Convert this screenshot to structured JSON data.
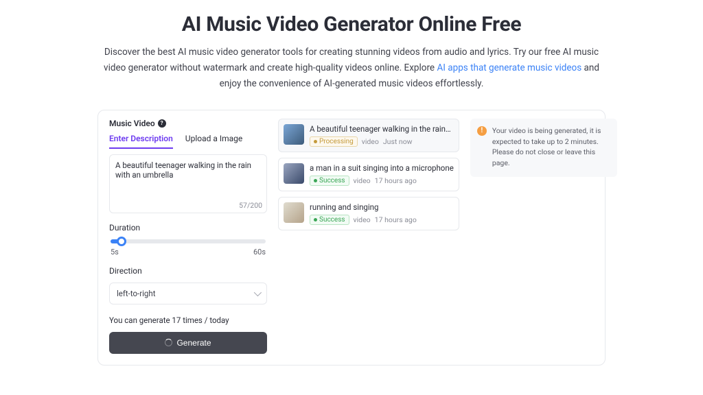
{
  "hero": {
    "title": "AI Music Video Generator Online Free",
    "desc_1": "Discover the best AI music video generator tools for creating stunning videos from audio and lyrics. Try our free AI music video generator without watermark and create high-quality videos online. Explore ",
    "link_text": "AI apps that generate music videos",
    "desc_2": " and enjoy the convenience of AI-generated music videos effortlessly."
  },
  "form": {
    "section_label": "Music Video",
    "tabs": {
      "enter_desc": "Enter Description",
      "upload_img": "Upload a Image"
    },
    "prompt_value": "A beautiful teenager walking in the rain with an umbrella",
    "char_count": "57/200",
    "duration_label": "Duration",
    "duration_min": "5s",
    "duration_max": "60s",
    "direction_label": "Direction",
    "direction_value": "left-to-right",
    "remaining_text": "You can generate 17 times / today",
    "generate_label": "Generate"
  },
  "jobs": [
    {
      "title": "A beautiful teenager walking in the rain…",
      "status": "Processing",
      "status_class": "processing",
      "type": "video",
      "time": "Just now",
      "active": true,
      "thumb": "t1"
    },
    {
      "title": "a man in a suit singing into a microphone",
      "status": "Success",
      "status_class": "success",
      "type": "video",
      "time": "17 hours ago",
      "active": false,
      "thumb": "t2"
    },
    {
      "title": "running and singing",
      "status": "Success",
      "status_class": "success",
      "type": "video",
      "time": "17 hours ago",
      "active": false,
      "thumb": "t3"
    }
  ],
  "notice": {
    "text": "Your video is being generated, it is expected to take up to 2 minutes. Please do not close or leave this page."
  }
}
